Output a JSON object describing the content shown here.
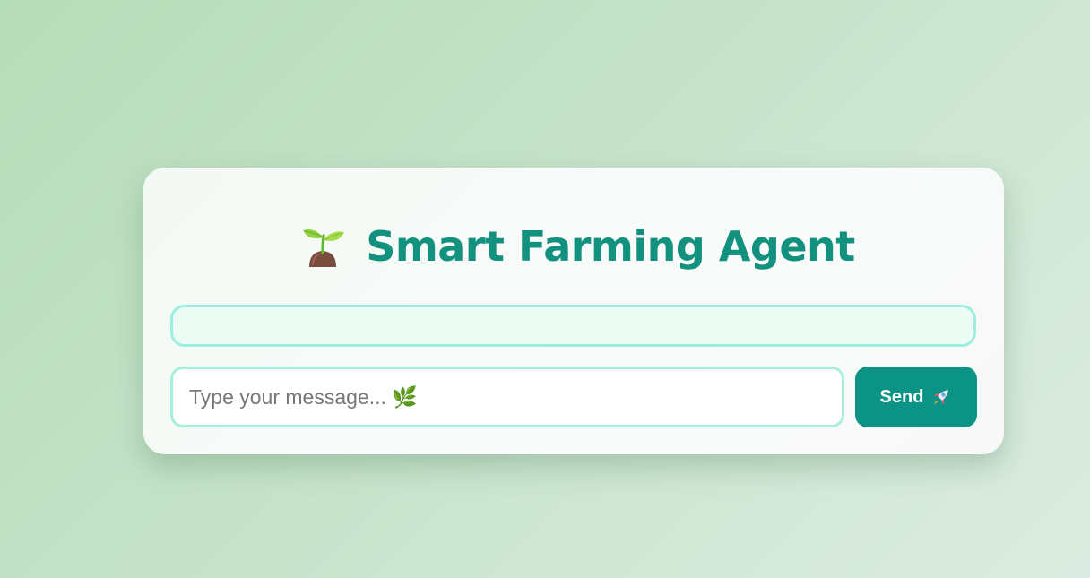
{
  "header": {
    "title_icon": "sprout-icon",
    "title": "Smart Farming Agent"
  },
  "chat": {
    "messages": []
  },
  "composer": {
    "placeholder": "Type your message... 🌿",
    "value": "",
    "send_label": "Send",
    "send_icon": "rocket-icon"
  },
  "colors": {
    "accent": "#12917f",
    "button": "#0b9485",
    "chat_border": "#9beee0",
    "chat_background": "#ebfcf4",
    "input_border": "#a8eedc"
  }
}
